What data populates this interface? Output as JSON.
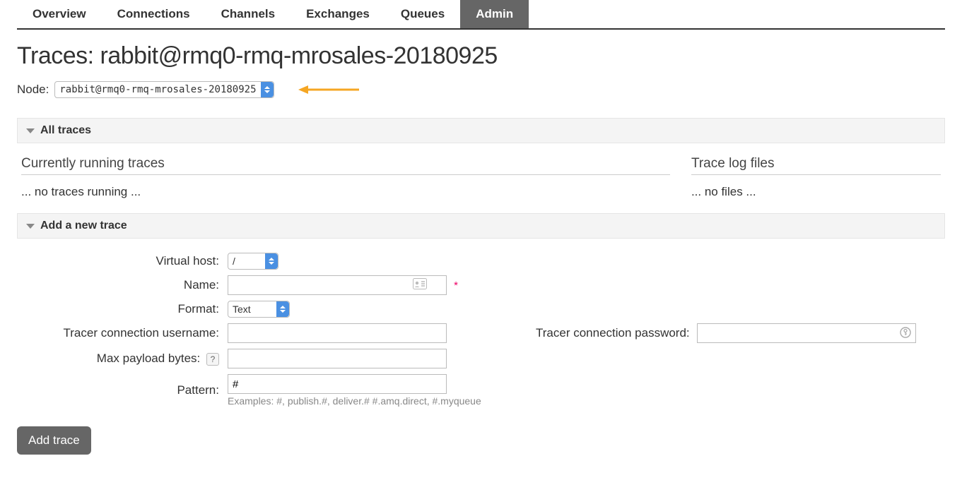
{
  "nav": {
    "tabs": [
      {
        "label": "Overview"
      },
      {
        "label": "Connections"
      },
      {
        "label": "Channels"
      },
      {
        "label": "Exchanges"
      },
      {
        "label": "Queues"
      },
      {
        "label": "Admin"
      }
    ]
  },
  "page": {
    "title": "Traces: rabbit@rmq0-rmq-mrosales-20180925",
    "node_label": "Node:",
    "node_value": "rabbit@rmq0-rmq-mrosales-20180925"
  },
  "sections": {
    "all_traces": {
      "header": "All traces",
      "running_heading": "Currently running traces",
      "running_empty": "... no traces running ...",
      "logs_heading": "Trace log files",
      "logs_empty": "... no files ..."
    },
    "add_trace": {
      "header": "Add a new trace",
      "labels": {
        "vhost": "Virtual host:",
        "name": "Name:",
        "format": "Format:",
        "username": "Tracer connection username:",
        "password": "Tracer connection password:",
        "max_payload": "Max payload bytes:",
        "pattern": "Pattern:"
      },
      "values": {
        "vhost": "/",
        "name": "",
        "format": "Text",
        "username": "",
        "password": "",
        "max_payload": "",
        "pattern": "#"
      },
      "hint_pattern": "Examples: #, publish.#, deliver.# #.amq.direct, #.myqueue",
      "help_badge": "?",
      "required_mark": "*",
      "submit_label": "Add trace"
    }
  }
}
